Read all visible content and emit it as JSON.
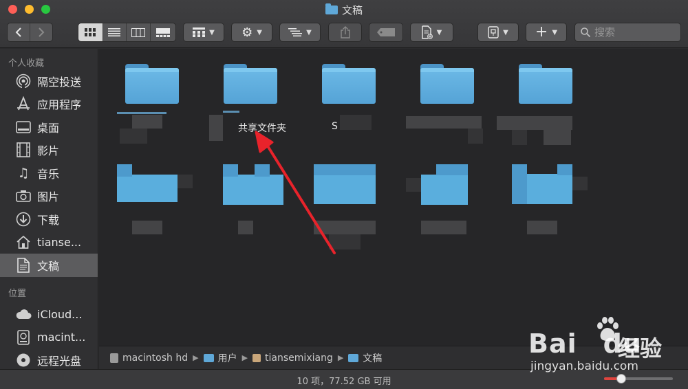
{
  "window": {
    "title": "文稿",
    "title_icon": "folder-icon"
  },
  "toolbar": {
    "back_icon": "chevron-left-icon",
    "forward_icon": "chevron-right-icon",
    "view_modes": [
      "icon-view-icon",
      "list-view-icon",
      "column-view-icon",
      "gallery-view-icon"
    ],
    "active_view": "icon-view-icon",
    "group_icon": "grid-group-icon",
    "action_icon": "gear-icon",
    "arrange_icon": "arrange-lines-icon",
    "share_icon": "share-icon",
    "tag_icon": "tag-icon",
    "new_doc_icon": "new-document-icon",
    "archive_icon": "archive-icon",
    "add_icon": "plus-icon",
    "search_placeholder": "搜索"
  },
  "sidebar": {
    "favorites_title": "个人收藏",
    "favorites": [
      {
        "label": "隔空投送",
        "icon": "airdrop-icon"
      },
      {
        "label": "应用程序",
        "icon": "applications-icon"
      },
      {
        "label": "桌面",
        "icon": "desktop-icon"
      },
      {
        "label": "影片",
        "icon": "film-icon"
      },
      {
        "label": "音乐",
        "icon": "music-icon"
      },
      {
        "label": "图片",
        "icon": "camera-icon"
      },
      {
        "label": "下载",
        "icon": "download-icon"
      },
      {
        "label": "tianse...",
        "icon": "home-icon"
      },
      {
        "label": "文稿",
        "icon": "document-icon",
        "selected": true
      }
    ],
    "locations_title": "位置",
    "locations": [
      {
        "label": "iCloud...",
        "icon": "cloud-icon"
      },
      {
        "label": "macint...",
        "icon": "harddisk-icon"
      },
      {
        "label": "远程光盘",
        "icon": "disc-icon"
      }
    ]
  },
  "content": {
    "visible_labels": [
      {
        "text": "共享文件夹"
      },
      {
        "text": "S"
      }
    ]
  },
  "pathbar": {
    "items": [
      {
        "label": "macintosh hd",
        "icon": "harddisk-icon"
      },
      {
        "label": "用户",
        "icon": "folder-icon"
      },
      {
        "label": "tiansemixiang",
        "icon": "home-icon"
      },
      {
        "label": "文稿",
        "icon": "folder-icon"
      }
    ]
  },
  "status": {
    "text": "10 项，77.52 GB 可用",
    "zoom_level": 0.25
  },
  "watermark": {
    "brand": "Bai",
    "brand_suffix": "du",
    "chinese": "经验",
    "url": "jingyan.baidu.com"
  },
  "colors": {
    "accent_red": "#e0443e",
    "folder_blue": "#5aaedd",
    "annotation_arrow": "#e8232b"
  }
}
